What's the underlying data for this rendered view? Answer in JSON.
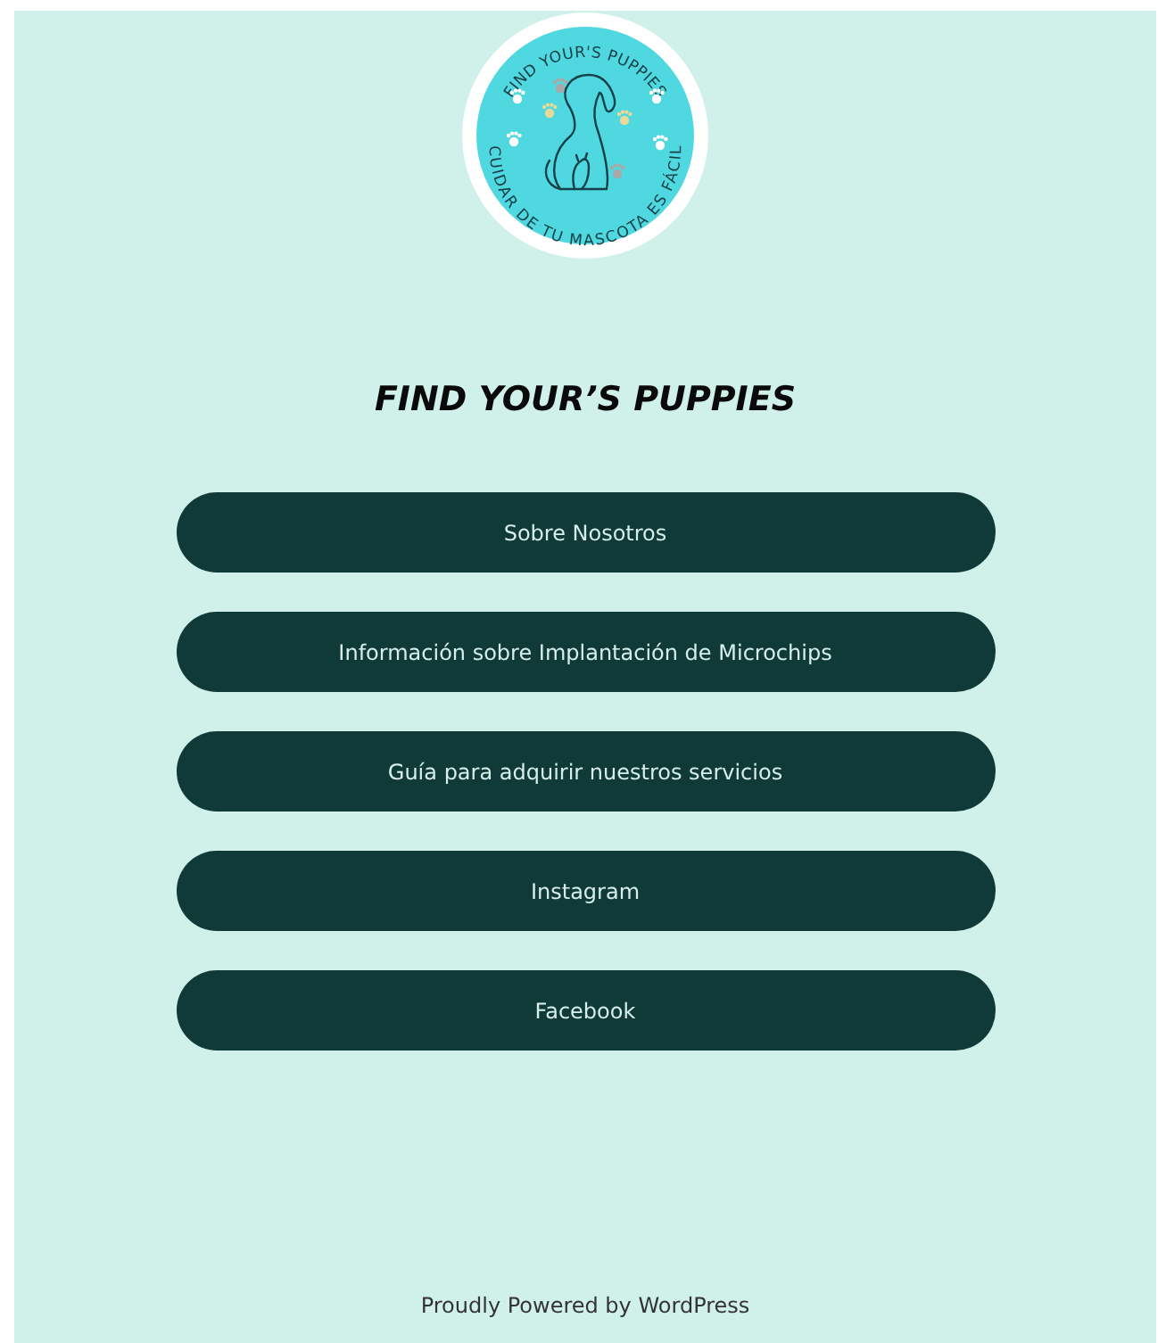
{
  "logo": {
    "top_text": "FIND YOUR'S PUPPIES",
    "bottom_text": "CUIDAR DE TU MASCOTA ES FÁCIL"
  },
  "site_title": "FIND YOUR’S PUPPIES",
  "nav_buttons": [
    {
      "label": "Sobre Nosotros"
    },
    {
      "label": "Información sobre Implantación de Microchips"
    },
    {
      "label": "Guía para adquirir nuestros servicios"
    },
    {
      "label": "Instagram"
    },
    {
      "label": "Facebook"
    }
  ],
  "footer": "Proudly Powered by WordPress"
}
